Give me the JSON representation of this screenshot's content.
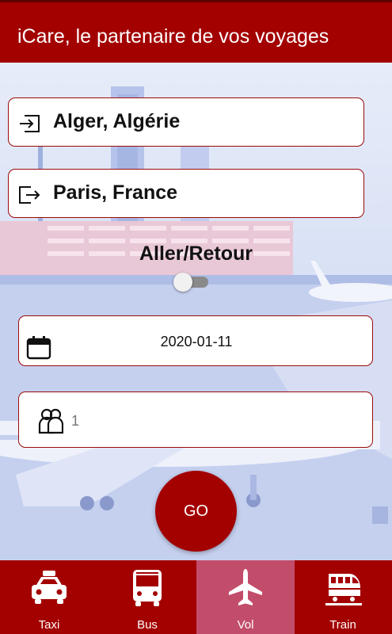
{
  "app": {
    "title": "iCare, le partenaire de vos voyages"
  },
  "search": {
    "origin": "Alger, Algérie",
    "destination": "Paris, France",
    "trip_type_label": "Aller/Retour",
    "round_trip_enabled": false,
    "date": "2020-01-11",
    "passengers_placeholder": "1",
    "go_label": "GO"
  },
  "icons": {
    "origin": "login-arrow-icon",
    "destination": "logout-arrow-icon",
    "date": "calendar-icon",
    "passengers": "people-icon"
  },
  "nav": {
    "items": [
      {
        "label": "Taxi",
        "icon": "taxi-icon",
        "active": false
      },
      {
        "label": "Bus",
        "icon": "bus-icon",
        "active": false
      },
      {
        "label": "Vol",
        "icon": "airplane-icon",
        "active": true
      },
      {
        "label": "Train",
        "icon": "train-icon",
        "active": false
      }
    ]
  },
  "colors": {
    "primary": "#a30000",
    "nav_active": "#c24d6a",
    "background": "#c9d3ee"
  }
}
